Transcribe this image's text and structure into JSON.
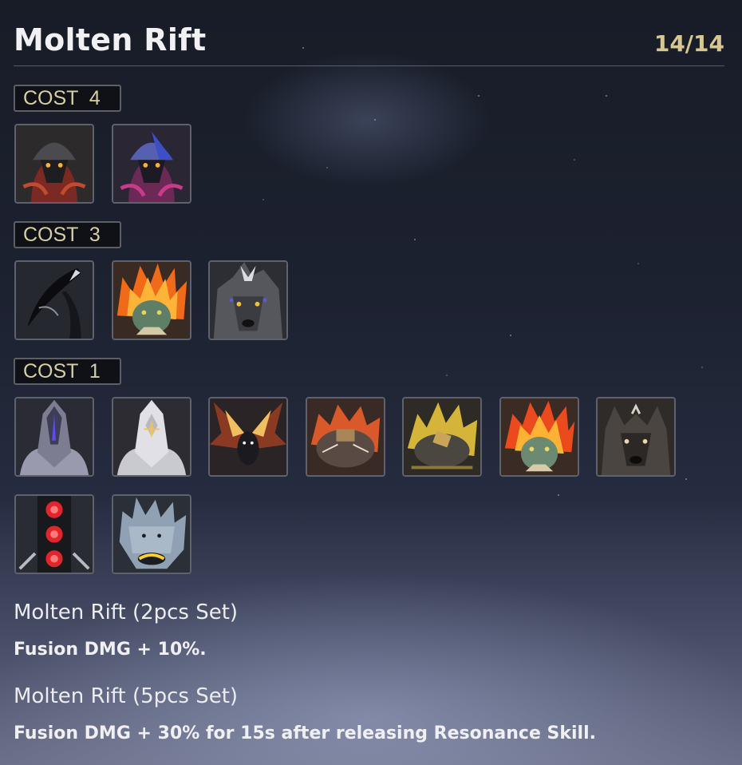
{
  "set": {
    "name": "Molten Rift",
    "progress": "14/14"
  },
  "cost_groups": [
    {
      "label": "COST  4",
      "echoes": [
        {
          "icon": "hooded-lava-golem-icon"
        },
        {
          "icon": "hooded-crystal-golem-icon"
        }
      ]
    },
    {
      "label": "COST  3",
      "echoes": [
        {
          "icon": "black-scythe-wing-icon"
        },
        {
          "icon": "flame-maned-lizard-icon"
        },
        {
          "icon": "grey-spiked-wolf-icon"
        }
      ]
    },
    {
      "label": "COST  1",
      "echoes": [
        {
          "icon": "purple-visor-knight-icon"
        },
        {
          "icon": "white-gold-knight-icon"
        },
        {
          "icon": "ember-moth-icon"
        },
        {
          "icon": "orange-rock-turtle-icon"
        },
        {
          "icon": "yellow-rock-turtle-icon"
        },
        {
          "icon": "orange-crested-lizard-icon"
        },
        {
          "icon": "dark-wolf-icon"
        },
        {
          "icon": "red-signal-tower-icon"
        },
        {
          "icon": "frost-spiked-beast-icon"
        }
      ]
    }
  ],
  "effects": [
    {
      "title": "Molten Rift (2pcs Set)",
      "description": "Fusion DMG + 10%."
    },
    {
      "title": "Molten Rift (5pcs Set)",
      "description": "Fusion DMG + 30% for 15s after releasing Resonance Skill."
    }
  ],
  "colors": {
    "title": "#f1f1f3",
    "count_gold": "#d8c790",
    "badge_text": "#d6cfa6",
    "tile_border": "#5e626d"
  }
}
